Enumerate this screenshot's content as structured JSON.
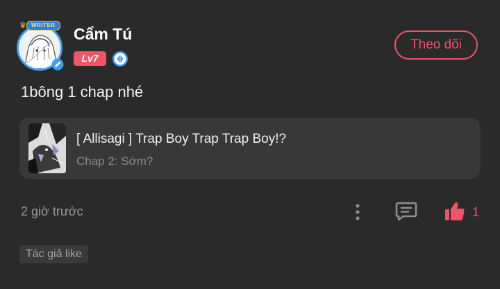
{
  "author": {
    "name": "Cẩm Tú",
    "avatar_badge": "WRITER",
    "level": "Lv7",
    "verified_icon": "diamond-verified-icon"
  },
  "follow_button": {
    "label": "Theo dõi"
  },
  "post": {
    "text": "1bông 1 chap nhé",
    "linked_story": {
      "title": "[ Allisagi ] Trap Boy Trap Trap Boy!?",
      "chapter": "Chap 2: Sớm?"
    },
    "timestamp": "2 giờ trước",
    "like_count": "1",
    "tag": "Tác giả like"
  },
  "colors": {
    "background": "#2a2a2a",
    "accent": "#f0546b",
    "card": "#383838",
    "muted_text": "#9a9a9a",
    "verified_blue": "#3f9df2"
  },
  "icons": {
    "more": "more-vertical-icon",
    "comment": "comment-icon",
    "like": "thumbs-up-icon"
  }
}
